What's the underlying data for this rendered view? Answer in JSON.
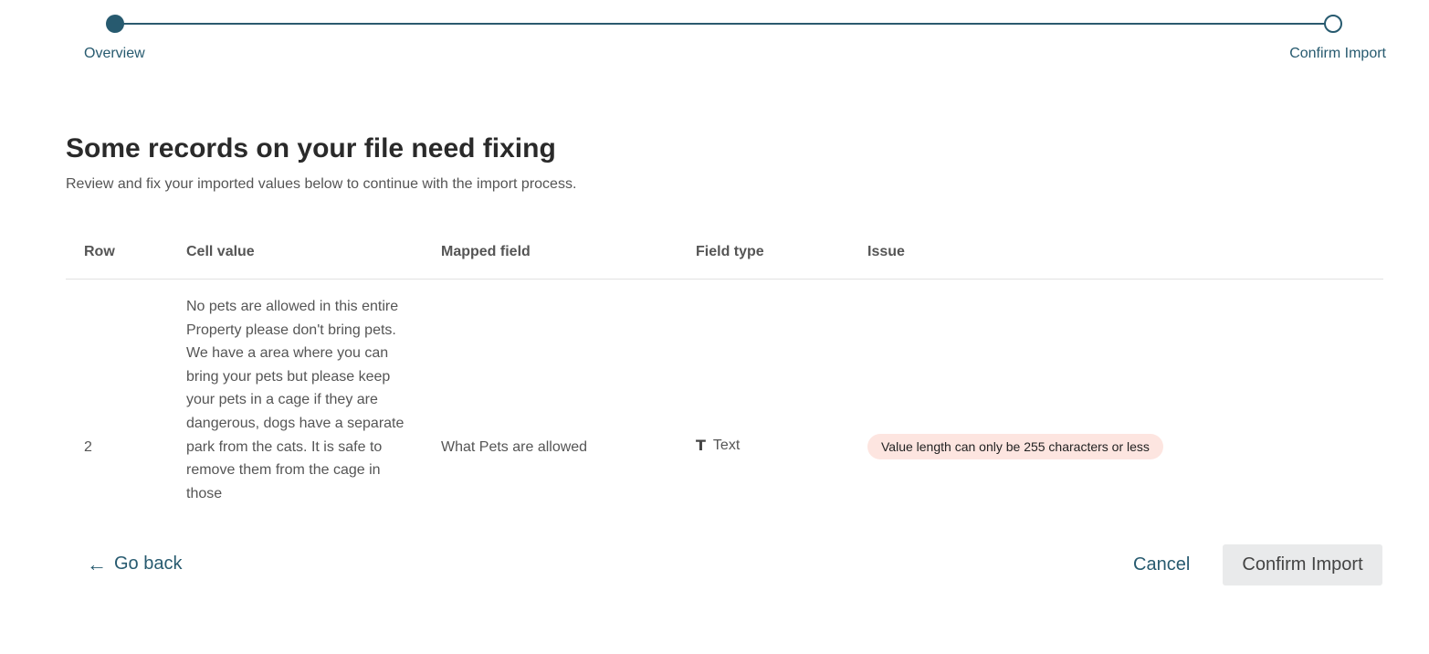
{
  "stepper": {
    "steps": [
      {
        "label": "Overview",
        "state": "completed"
      },
      {
        "label": "Confirm Import",
        "state": "current"
      }
    ]
  },
  "header": {
    "title": "Some records on your file need fixing",
    "subtitle": "Review and fix your imported values below to continue with the import process."
  },
  "table": {
    "columns": [
      "Row",
      "Cell value",
      "Mapped field",
      "Field type",
      "Issue"
    ],
    "rows": [
      {
        "row": "2",
        "cell_value": "No pets are allowed in this entire Property please don't bring pets. We have a area where you can bring your pets but please keep your pets in a cage if they are dangerous, dogs have a separate park from the cats. It is safe to remove them from the cage in those",
        "mapped_field": "What Pets are allowed",
        "field_type": "Text",
        "field_type_icon": "text-type-icon",
        "issue": "Value length can only be 255 characters or less"
      }
    ]
  },
  "footer": {
    "go_back_label": "Go back",
    "cancel_label": "Cancel",
    "confirm_label": "Confirm Import"
  },
  "colors": {
    "accent": "#275a6f",
    "issue_badge_bg": "#fde5e0",
    "button_bg": "#e9eaeb"
  }
}
